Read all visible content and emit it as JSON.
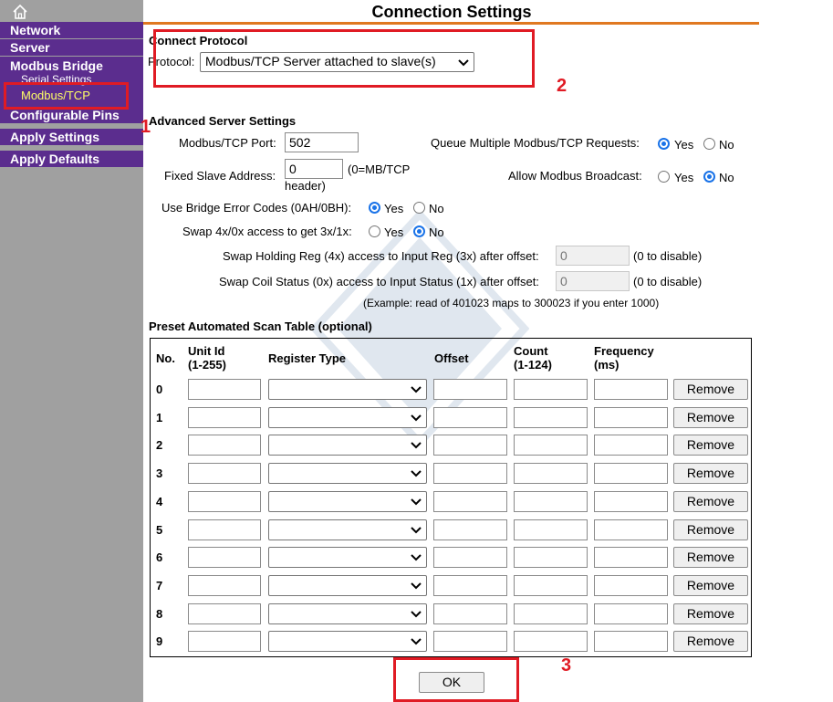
{
  "sidebar": {
    "items": [
      {
        "label": "Network"
      },
      {
        "label": "Server"
      },
      {
        "label": "Modbus Bridge"
      },
      {
        "label": "Configurable Pins"
      },
      {
        "label": "Apply Settings"
      },
      {
        "label": "Apply Defaults"
      }
    ],
    "subitems": [
      {
        "label": "Serial Settings"
      },
      {
        "label": "Modbus/TCP"
      }
    ]
  },
  "page": {
    "title": "Connection Settings"
  },
  "connect": {
    "heading": "Connect Protocol",
    "protocol_label": "Protocol:",
    "protocol_value": "Modbus/TCP Server attached to slave(s)"
  },
  "advanced": {
    "heading": "Advanced Server Settings",
    "port_label": "Modbus/TCP Port:",
    "port_value": "502",
    "queue_label": "Queue Multiple Modbus/TCP Requests:",
    "slave_label": "Fixed Slave Address:",
    "slave_value": "0",
    "slave_hint_1": "(0=MB/TCP",
    "slave_hint_2": "header)",
    "broadcast_label": "Allow Modbus Broadcast:",
    "error_codes_label": "Use Bridge Error Codes (0AH/0BH):",
    "swap_label": "Swap 4x/0x access to get 3x/1x:",
    "swap_holding_label": "Swap Holding Reg (4x) access to Input Reg (3x) after offset:",
    "swap_holding_placeholder": "0",
    "swap_coil_label": "Swap Coil Status (0x) access to Input Status (1x) after offset:",
    "swap_coil_placeholder": "0",
    "disable_hint": "(0 to disable)",
    "example": "(Example: read of 401023 maps to 300023 if you enter 1000)",
    "yes": "Yes",
    "no": "No"
  },
  "scan": {
    "heading": "Preset Automated Scan Table (optional)",
    "headers": {
      "no": "No.",
      "unit_id_1": "Unit Id",
      "unit_id_2": "(1-255)",
      "register_type": "Register Type",
      "offset": "Offset",
      "count_1": "Count",
      "count_2": "(1-124)",
      "frequency_1": "Frequency",
      "frequency_2": "(ms)"
    },
    "rows": [
      "0",
      "1",
      "2",
      "3",
      "4",
      "5",
      "6",
      "7",
      "8",
      "9"
    ],
    "remove_label": "Remove"
  },
  "footer": {
    "ok_label": "OK"
  },
  "annotations": [
    "1",
    "2",
    "3"
  ]
}
